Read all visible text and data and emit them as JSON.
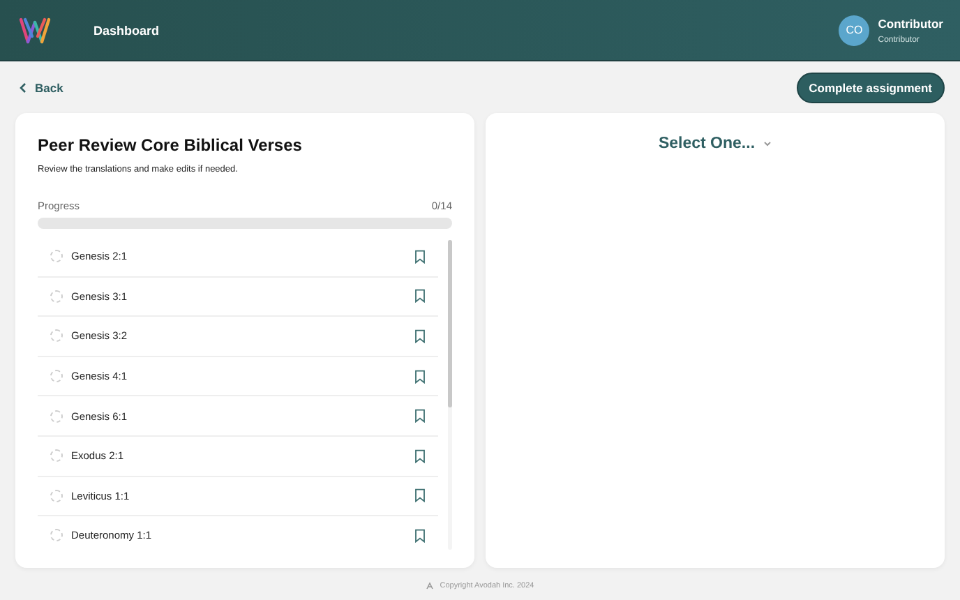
{
  "header": {
    "nav_label": "Dashboard",
    "user": {
      "initials": "CO",
      "name": "Contributor",
      "role": "Contributor"
    }
  },
  "back_label": "Back",
  "complete_button": "Complete assignment",
  "assignment": {
    "title": "Peer Review Core Biblical Verses",
    "description": "Review the translations and make edits if needed.",
    "progress_label": "Progress",
    "progress_count": "0/14",
    "level": 0
  },
  "verses": [
    {
      "label": "Genesis 2:1",
      "checked": false
    },
    {
      "label": "Genesis 3:1",
      "checked": false
    },
    {
      "label": "Genesis 3:2",
      "checked": false
    },
    {
      "label": "Genesis 4:1",
      "checked": false
    },
    {
      "label": "Genesis 6:1",
      "checked": false
    },
    {
      "label": "Exodus 2:1",
      "checked": false
    },
    {
      "label": "Leviticus 1:1",
      "checked": false
    },
    {
      "label": "Deuteronomy 1:1",
      "checked": false
    }
  ],
  "selector": {
    "label": "Select One..."
  },
  "footer": "Copyright Avodah Inc. 2024"
}
